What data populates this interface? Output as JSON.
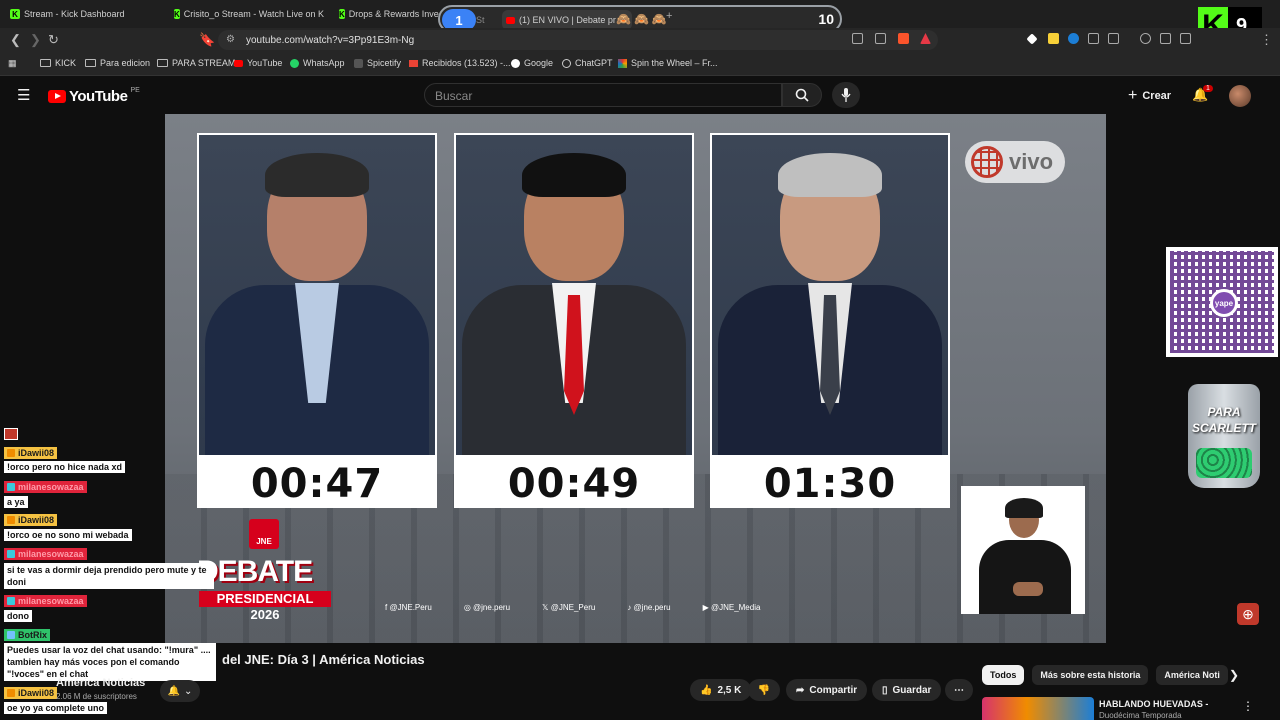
{
  "browser": {
    "tabs": [
      {
        "label": "Stream - Kick Dashboard"
      },
      {
        "label": "Crisito_o Stream - Watch Live on Kick"
      },
      {
        "label": "Drops & Rewards Invent"
      }
    ],
    "tab_group": {
      "badge": "1",
      "partial": "St",
      "active_tab": "(1)   EN VIVO | Debate pr",
      "count": "10",
      "emoji": "🙈🙈🙈"
    },
    "kick_badge": {
      "letter": "K",
      "number": "9"
    },
    "url": "youtube.com/watch?v=3Pp91E3m-Ng"
  },
  "bookmarks": [
    {
      "label": "KICK",
      "icon": "folder-icon"
    },
    {
      "label": "Para edicion",
      "icon": "folder-icon"
    },
    {
      "label": "PARA STREAM",
      "icon": "folder-icon"
    },
    {
      "label": "YouTube",
      "icon": "youtube-icon"
    },
    {
      "label": "WhatsApp",
      "icon": "whatsapp-icon"
    },
    {
      "label": "Spicetify",
      "icon": "spicetify-icon"
    },
    {
      "label": "Recibidos (13.523) -...",
      "icon": "gmail-icon"
    },
    {
      "label": "Google",
      "icon": "google-icon"
    },
    {
      "label": "ChatGPT",
      "icon": "chatgpt-icon"
    },
    {
      "label": "Spin the Wheel – Fr...",
      "icon": "wheel-icon"
    }
  ],
  "youtube": {
    "logo": "YouTube",
    "region": "PE",
    "search_placeholder": "Buscar",
    "create_label": "Crear",
    "notifications": "1"
  },
  "video": {
    "timers": [
      "00:47",
      "00:49",
      "01:30"
    ],
    "live_badge": "vivo",
    "jne": "JNE",
    "debate_word": "DEBATE",
    "debate_word2": "PRESIDENCIAL",
    "debate_year": "2026",
    "socials": [
      "@JNE.Peru",
      "@jne.peru",
      "@JNE_Peru",
      "@jne.peru",
      "@JNE_Media"
    ],
    "colors": {
      "jne_red": "#d6001c"
    }
  },
  "overlays": {
    "yape": "yape",
    "jar_label": "PARA SCARLETT"
  },
  "chat": [
    {
      "user": "iDawii08",
      "msg": "!orco pero no hice nada xd",
      "color": "y"
    },
    {
      "user": "milanesowazaa",
      "msg": "a ya",
      "color": "r"
    },
    {
      "user": "iDawii08",
      "msg": "!orco oe no sono mi webada",
      "color": "y"
    },
    {
      "user": "milanesowazaa",
      "msg": "si te vas a dormir deja prendido pero mute y te doni",
      "color": "r"
    },
    {
      "user": "milanesowazaa",
      "msg": "dono",
      "color": "r"
    },
    {
      "user": "BotRix",
      "msg": "Puedes usar la voz del chat usando: \"!mura\" .... tambien hay más voces pon el comando \"!voces\" en el chat",
      "color": "g"
    },
    {
      "user": "iDawii08",
      "msg": "oe yo ya complete uno",
      "color": "y"
    }
  ],
  "below": {
    "title": "del JNE: Día 3 | América Noticias",
    "channel": "América Noticias",
    "subscribers": "2.06 M de suscriptores",
    "likes": "2,5 K",
    "share": "Compartir",
    "save": "Guardar",
    "chips": [
      "Todos",
      "Más sobre esta historia",
      "América Noti"
    ],
    "reco_title": "HABLANDO HUEVADAS -",
    "reco_sub": "Duodécima Temporada"
  }
}
